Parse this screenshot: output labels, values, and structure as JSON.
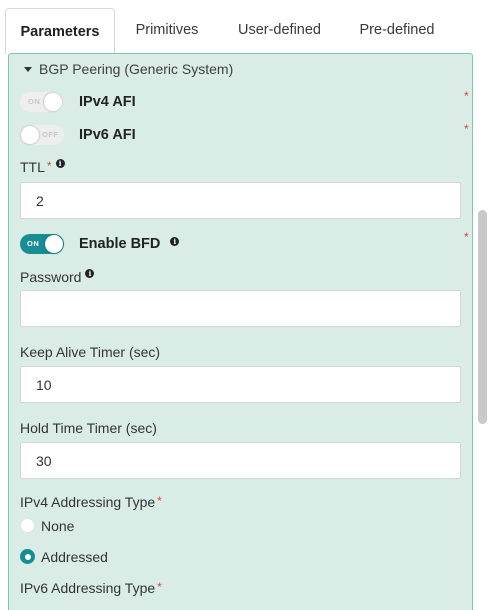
{
  "tabs": [
    {
      "label": "Parameters",
      "active": true
    },
    {
      "label": "Primitives"
    },
    {
      "label": "User-defined"
    },
    {
      "label": "Pre-defined"
    }
  ],
  "section": {
    "title": "BGP Peering (Generic System)"
  },
  "ipv4_afi": {
    "label": "IPv4 AFI",
    "toggle_text": "ON",
    "state": "off-disabled"
  },
  "ipv6_afi": {
    "label": "IPv6 AFI",
    "toggle_text": "OFF",
    "state": "off"
  },
  "ttl": {
    "label": "TTL",
    "value": "2"
  },
  "bfd": {
    "label": "Enable BFD",
    "toggle_text": "ON",
    "state": "on"
  },
  "password": {
    "label": "Password",
    "value": ""
  },
  "keepalive": {
    "label": "Keep Alive Timer (sec)",
    "value": "10"
  },
  "holdtime": {
    "label": "Hold Time Timer (sec)",
    "value": "30"
  },
  "ipv4_addressing": {
    "label": "IPv4 Addressing Type",
    "options": [
      {
        "label": "None",
        "checked": false
      },
      {
        "label": "Addressed",
        "checked": true
      }
    ]
  },
  "ipv6_addressing": {
    "label": "IPv6 Addressing Type"
  },
  "required_mark": "*",
  "info_glyph": "i",
  "colors": {
    "accent": "#178d94",
    "panel_bg": "#d9ede6",
    "panel_border": "#7cc7ad",
    "required": "#d64541"
  }
}
